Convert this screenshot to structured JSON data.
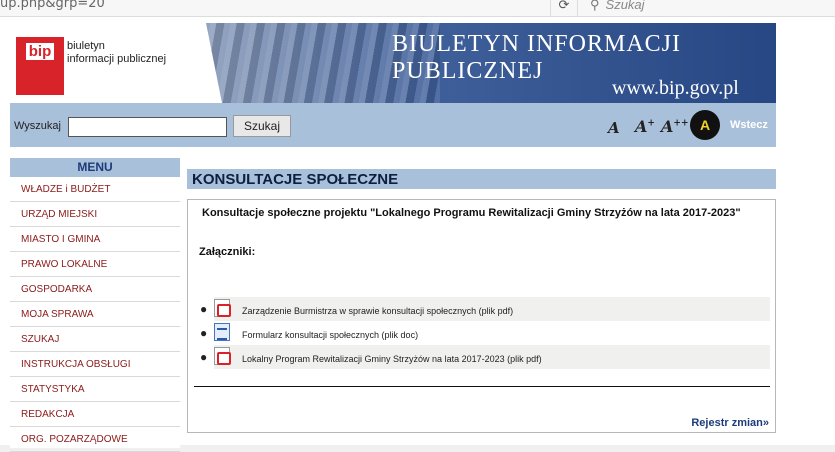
{
  "browser": {
    "url": "up.php&grp=20",
    "reload_glyph": "⟳",
    "search_placeholder": "Szukaj",
    "search_glyph": "⚲"
  },
  "banner": {
    "logo_badge": "bip",
    "logo_line1": "biuletyn",
    "logo_line2": "informacji publicznej",
    "title_line1": "BIULETYN INFORMACJI",
    "title_line2": "PUBLICZNEJ",
    "site_url": "www.bip.gov.pl"
  },
  "search": {
    "label": "Wyszukaj",
    "value": "",
    "button": "Szukaj"
  },
  "accessibility": {
    "font_small": "A",
    "font_medium": "A",
    "font_medium_sup": "+",
    "font_large": "A",
    "font_large_sup": "++",
    "contrast": "A",
    "back": "Wstecz"
  },
  "menu": {
    "header": "MENU",
    "items": [
      "WŁADZE i BUDŻET",
      "URZĄD MIEJSKI",
      "MIASTO I GMINA",
      "PRAWO LOKALNE",
      "GOSPODARKA",
      "MOJA SPRAWA",
      "SZUKAJ",
      "INSTRUKCJA OBSŁUGI",
      "STATYSTYKA",
      "REDAKCJA",
      "ORG. POZARZĄDOWE"
    ]
  },
  "content": {
    "title": "KONSULTACJE SPOŁECZNE",
    "subject": "Konsultacje społeczne projektu \"Lokalnego Programu Rewitalizacji Gminy Strzyżów na lata 2017-2023\"",
    "attachments_label": "Załączniki:",
    "attachments": [
      {
        "icon": "pdf-file-icon",
        "text": "Zarządzenie Burmistrza w sprawie konsultacji społecznych (plik pdf)"
      },
      {
        "icon": "doc-file-icon",
        "text": "Formularz konsultacji społecznych (plik doc)"
      },
      {
        "icon": "pdf-file-icon",
        "text": "Lokalny Program Rewitalizacji Gminy Strzyżów na lata 2017-2023 (plik pdf)"
      }
    ],
    "registry_link": "Rejestr zmian»"
  }
}
